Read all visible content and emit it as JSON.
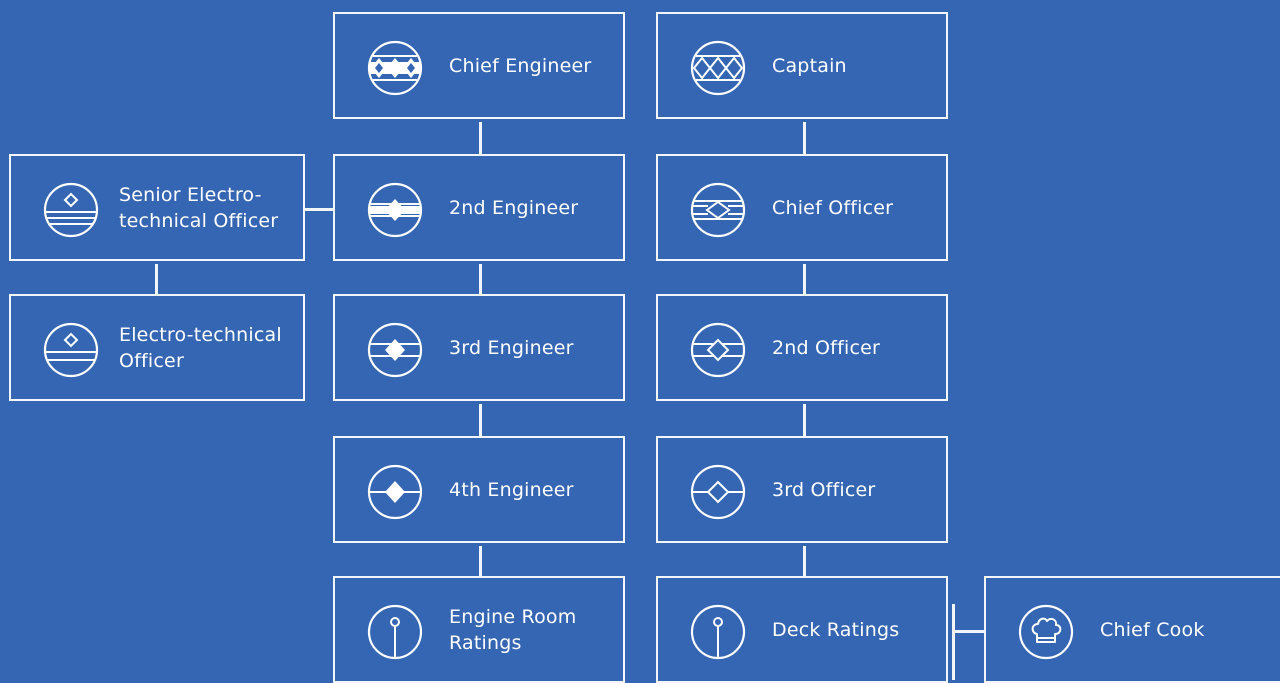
{
  "nodes": {
    "chief_engineer": {
      "label": "Chief Engineer",
      "icon": "insignia-three-diamonds-icon"
    },
    "second_engineer": {
      "label": "2nd Engineer",
      "icon": "insignia-engine-icon"
    },
    "third_engineer": {
      "label": "3rd Engineer",
      "icon": "insignia-engine-icon"
    },
    "fourth_engineer": {
      "label": "4th Engineer",
      "icon": "insignia-engine-icon"
    },
    "engine_room_ratings": {
      "label": "Engine Room\nRatings",
      "icon": "rating-pin-icon"
    },
    "captain": {
      "label": "Captain",
      "icon": "insignia-lattice-icon"
    },
    "chief_officer": {
      "label": "Chief Officer",
      "icon": "insignia-deck-icon"
    },
    "second_officer": {
      "label": "2nd Officer",
      "icon": "insignia-deck-icon"
    },
    "third_officer": {
      "label": "3rd Officer",
      "icon": "insignia-deck-icon"
    },
    "deck_ratings": {
      "label": "Deck Ratings",
      "icon": "rating-pin-icon"
    },
    "senior_eto": {
      "label": "Senior Electro-\ntechnical Officer",
      "icon": "insignia-electro-icon"
    },
    "eto": {
      "label": "Electro-technical\nOfficer",
      "icon": "insignia-electro-icon"
    },
    "chief_cook": {
      "label": "Chief Cook",
      "icon": "chef-hat-icon"
    }
  }
}
